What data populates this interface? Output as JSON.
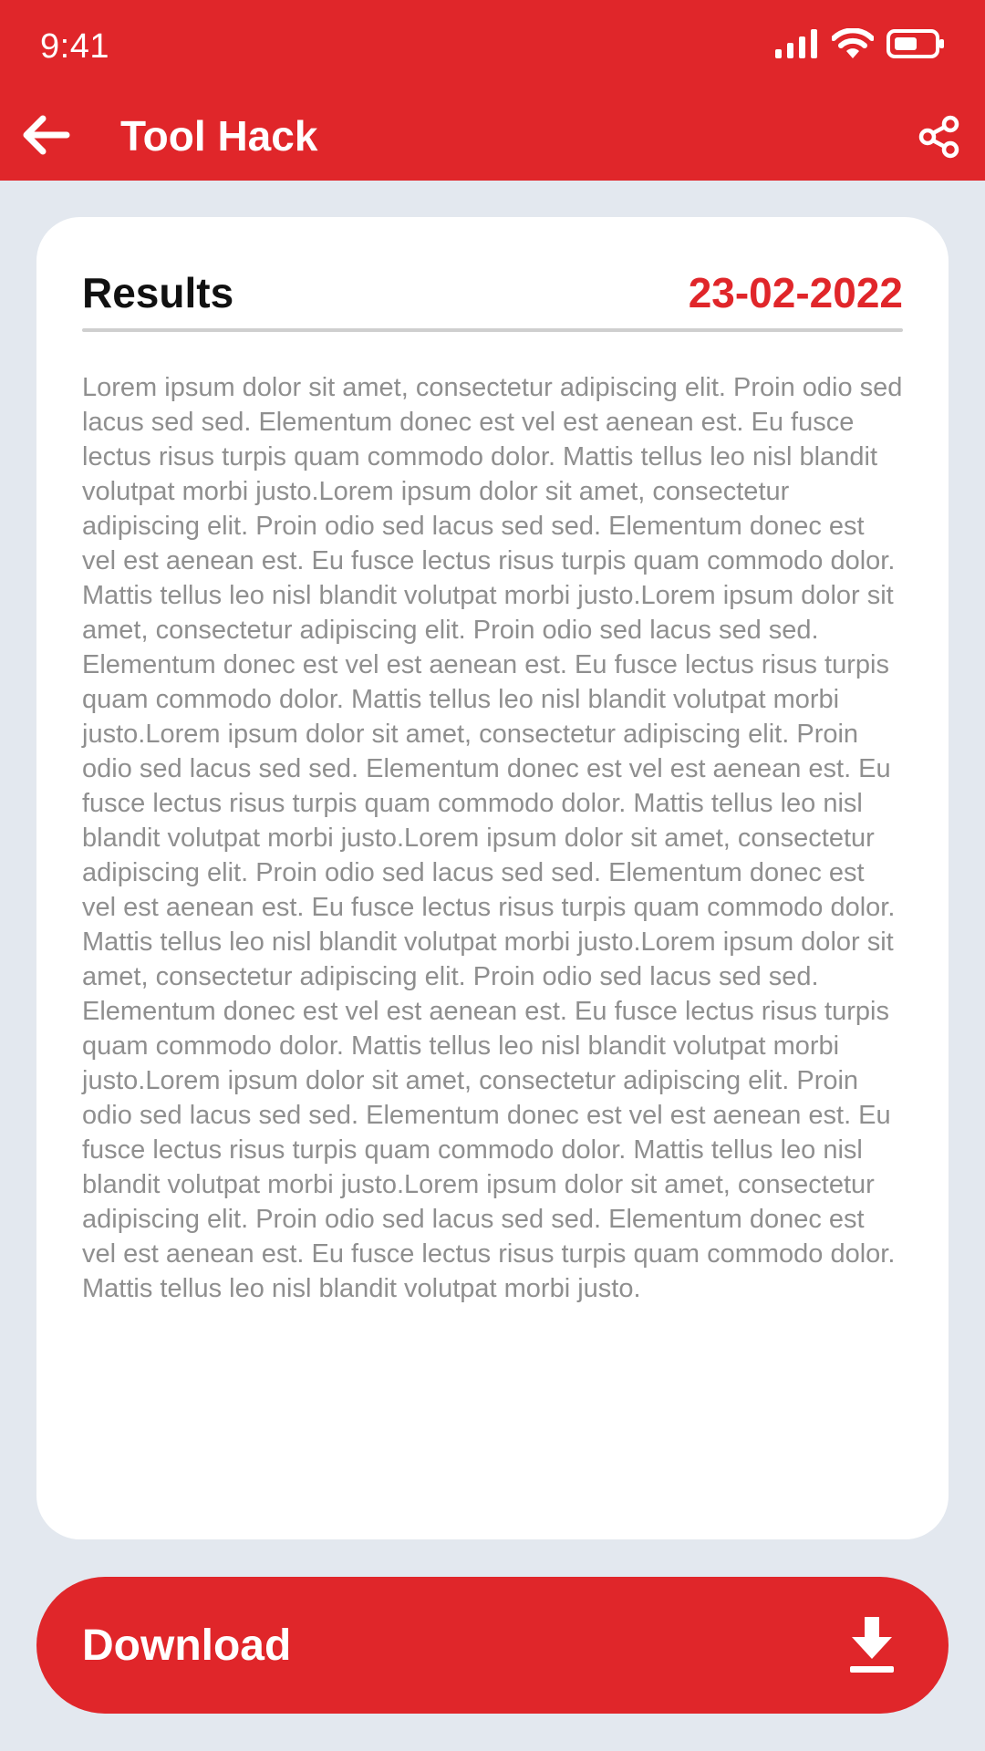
{
  "status_bar": {
    "time": "9:41"
  },
  "app_bar": {
    "title": "Tool Hack"
  },
  "results_card": {
    "title": "Results",
    "date": "23-02-2022",
    "body": "Lorem ipsum dolor sit amet, consectetur adipiscing elit. Proin odio sed lacus sed sed. Elementum donec est vel est aenean est. Eu fusce lectus risus turpis quam commodo dolor. Mattis tellus leo nisl blandit volutpat morbi justo.Lorem ipsum dolor sit amet, consectetur adipiscing elit. Proin odio sed lacus sed sed. Elementum donec est vel est aenean est. Eu fusce lectus risus turpis quam commodo dolor. Mattis tellus leo nisl blandit volutpat morbi justo.Lorem ipsum dolor sit amet, consectetur adipiscing elit. Proin odio sed lacus sed sed. Elementum donec est vel est aenean est. Eu fusce lectus risus turpis quam commodo dolor. Mattis tellus leo nisl blandit volutpat morbi justo.Lorem ipsum dolor sit amet, consectetur adipiscing elit. Proin odio sed lacus sed sed. Elementum donec est vel est aenean est. Eu fusce lectus risus turpis quam commodo dolor. Mattis tellus leo nisl blandit volutpat morbi justo.Lorem ipsum dolor sit amet, consectetur adipiscing elit. Proin odio sed lacus sed sed. Elementum donec est vel est aenean est. Eu fusce lectus risus turpis quam commodo dolor. Mattis tellus leo nisl blandit volutpat morbi justo.Lorem ipsum dolor sit amet, consectetur adipiscing elit. Proin odio sed lacus sed sed. Elementum donec est vel est aenean est. Eu fusce lectus risus turpis quam commodo dolor. Mattis tellus leo nisl blandit volutpat morbi justo.Lorem ipsum dolor sit amet, consectetur adipiscing elit. Proin odio sed lacus sed sed. Elementum donec est vel est aenean est. Eu fusce lectus risus turpis quam commodo dolor. Mattis tellus leo nisl blandit volutpat morbi justo.Lorem ipsum dolor sit amet, consectetur adipiscing elit. Proin odio sed lacus sed sed. Elementum donec est vel est aenean est. Eu fusce lectus risus turpis quam commodo dolor. Mattis tellus leo nisl blandit volutpat morbi justo."
  },
  "download_button": {
    "label": "Download"
  },
  "icons": {
    "back": "arrow-left-icon",
    "share": "share-icon",
    "download": "download-icon",
    "signal": "signal-icon",
    "wifi": "wifi-icon",
    "battery": "battery-icon"
  },
  "colors": {
    "brand": "#e0262a",
    "background": "#e3e8ef",
    "card": "#ffffff",
    "body_text": "#8f8f8f"
  }
}
